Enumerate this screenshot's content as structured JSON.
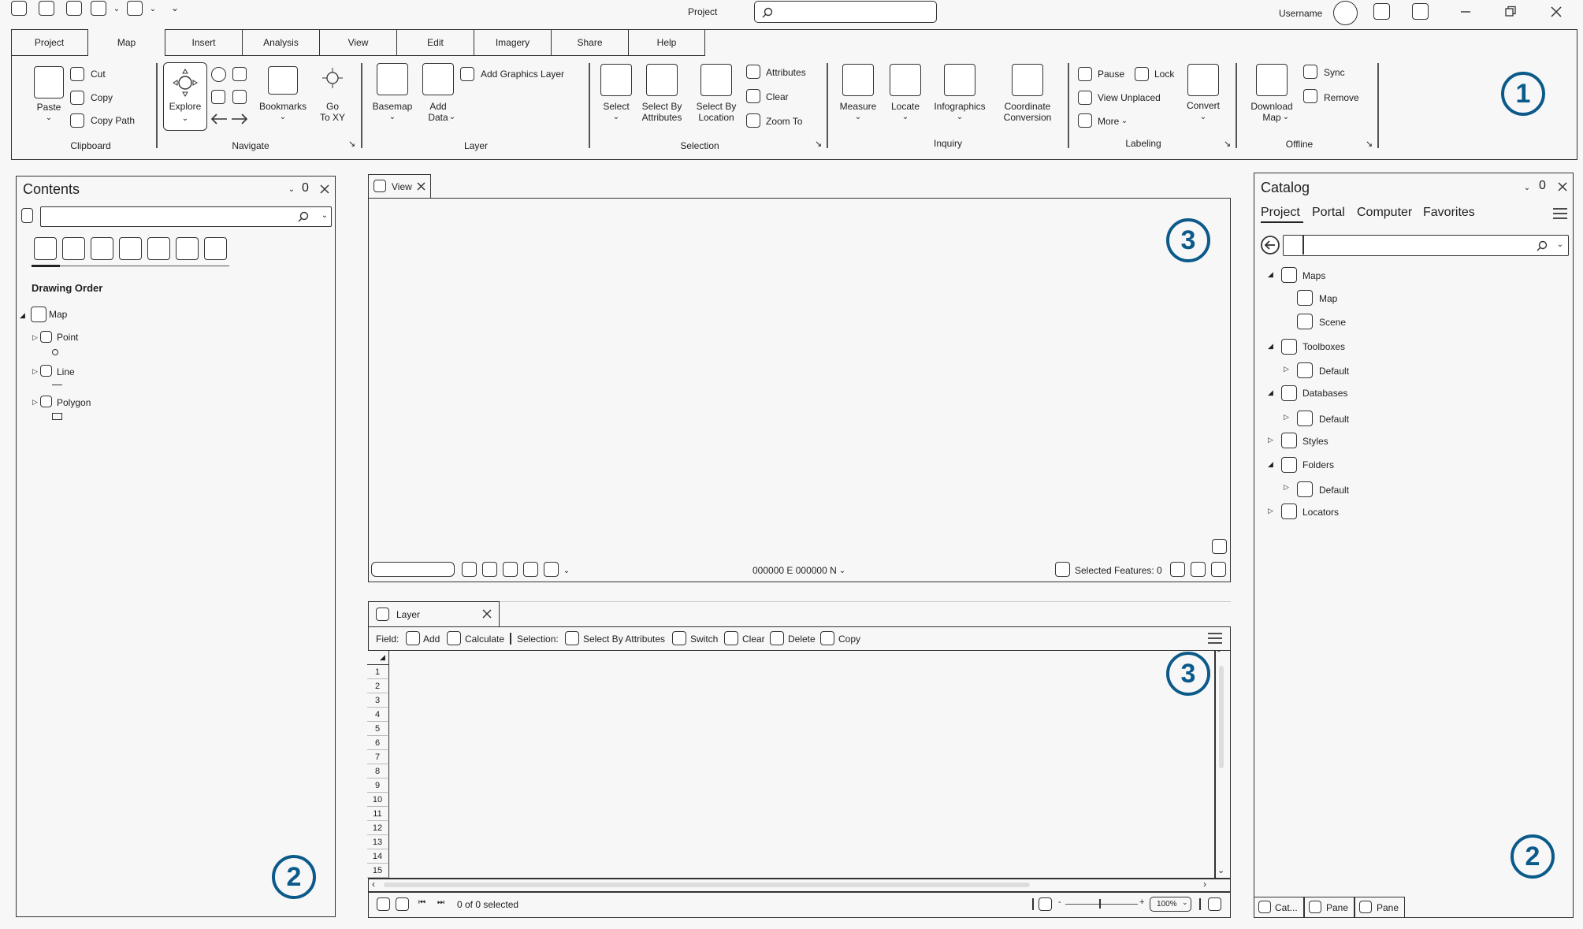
{
  "title_bar": {
    "project_name": "Project",
    "search_placeholder": "",
    "username": "Username",
    "icons": [
      "search-icon",
      "minimize-icon",
      "restore-icon",
      "close-icon"
    ]
  },
  "ribbon": {
    "tabs": [
      "Project",
      "Map",
      "Insert",
      "Analysis",
      "View",
      "Edit",
      "Imagery",
      "Share",
      "Help"
    ],
    "active_tab": "Map",
    "clipboard": {
      "paste": "Paste",
      "cut": "Cut",
      "copy": "Copy",
      "copy_path": "Copy Path",
      "group": "Clipboard"
    },
    "navigate": {
      "explore": "Explore",
      "bookmarks": "Bookmarks",
      "go_to": "Go",
      "go_to_2": "To XY",
      "group": "Navigate"
    },
    "layer": {
      "basemap": "Basemap",
      "add_data": "Add",
      "add_data_2": "Data",
      "add_graphics": "Add Graphics Layer",
      "group": "Layer"
    },
    "selection": {
      "select": "Select",
      "by_attr": "Select By",
      "by_attr_2": "Attributes",
      "by_loc": "Select By",
      "by_loc_2": "Location",
      "attributes": "Attributes",
      "clear": "Clear",
      "zoom_to": "Zoom To",
      "group": "Selection"
    },
    "inquiry": {
      "measure": "Measure",
      "locate": "Locate",
      "infographics": "Infographics",
      "coord": "Coordinate",
      "coord_2": "Conversion",
      "group": "Inquiry"
    },
    "labeling": {
      "pause": "Pause",
      "lock": "Lock",
      "view_unplaced": "View Unplaced",
      "more": "More",
      "convert": "Convert",
      "group": "Labeling"
    },
    "offline": {
      "download": "Download",
      "download_2": "Map",
      "sync": "Sync",
      "remove": "Remove",
      "group": "Offline"
    }
  },
  "badges": {
    "ribbon": "1",
    "side": "2",
    "center": "3"
  },
  "contents": {
    "title": "Contents",
    "drawing_order": "Drawing Order",
    "map": "Map",
    "layers": [
      "Point",
      "Line",
      "Polygon"
    ]
  },
  "view": {
    "tab": "View",
    "coords": "000000 E 000000 N",
    "selected": "Selected Features: 0"
  },
  "table": {
    "tab": "Layer",
    "field_label": "Field:",
    "add": "Add",
    "calculate": "Calculate",
    "selection_label": "Selection:",
    "select_by_attr": "Select By Attributes",
    "switch": "Switch",
    "clear": "Clear",
    "delete": "Delete",
    "copy": "Copy",
    "rows": [
      "1",
      "2",
      "3",
      "4",
      "5",
      "6",
      "7",
      "8",
      "9",
      "10",
      "11",
      "12",
      "13",
      "14",
      "15"
    ],
    "status": "0 of 0 selected",
    "zoom": "100%"
  },
  "catalog": {
    "title": "Catalog",
    "tabs": [
      "Project",
      "Portal",
      "Computer",
      "Favorites"
    ],
    "active_tab": "Project",
    "tree": [
      "Maps",
      "Map",
      "Scene",
      "Toolboxes",
      "Default",
      "Databases",
      "Default",
      "Styles",
      "Folders",
      "Default",
      "Locators"
    ],
    "bottom_tabs": [
      "Cat...",
      "Pane",
      "Pane"
    ]
  }
}
